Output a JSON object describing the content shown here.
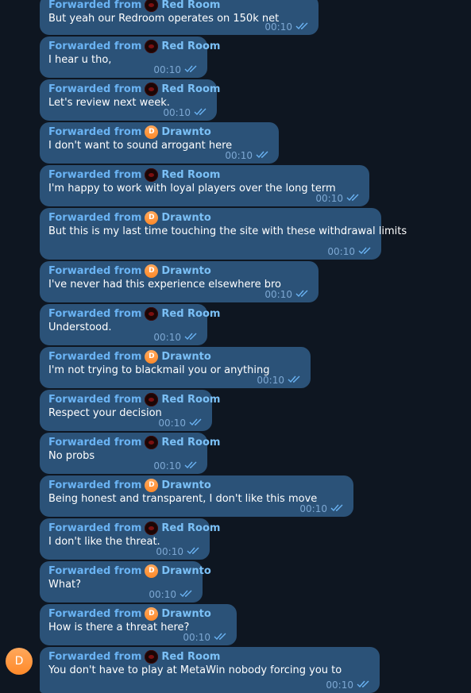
{
  "messages": [
    {
      "forward_label": "Forwarded from",
      "sender": "Red Room",
      "avatar": "red",
      "avatar_initial": "",
      "text": "But yeah our Redroom operates on 150k net",
      "time": "00:10"
    },
    {
      "forward_label": "Forwarded from",
      "sender": "Red Room",
      "avatar": "red",
      "avatar_initial": "",
      "text": "I hear u tho,",
      "time": "00:10"
    },
    {
      "forward_label": "Forwarded from",
      "sender": "Red Room",
      "avatar": "red",
      "avatar_initial": "",
      "text": "Let's review next week.",
      "time": "00:10"
    },
    {
      "forward_label": "Forwarded from",
      "sender": "Drawnto",
      "avatar": "orange",
      "avatar_initial": "D",
      "text": "I don't want to sound arrogant here",
      "time": "00:10"
    },
    {
      "forward_label": "Forwarded from",
      "sender": "Red Room",
      "avatar": "red",
      "avatar_initial": "",
      "text": "I'm happy to work with loyal players over the long term",
      "time": "00:10"
    },
    {
      "forward_label": "Forwarded from",
      "sender": "Drawnto",
      "avatar": "orange",
      "avatar_initial": "D",
      "text": "But this is my last time touching the site with these withdrawal limits",
      "time": "00:10"
    },
    {
      "forward_label": "Forwarded from",
      "sender": "Drawnto",
      "avatar": "orange",
      "avatar_initial": "D",
      "text": "I've never had this experience elsewhere bro",
      "time": "00:10"
    },
    {
      "forward_label": "Forwarded from",
      "sender": "Red Room",
      "avatar": "red",
      "avatar_initial": "",
      "text": "Understood.",
      "time": "00:10"
    },
    {
      "forward_label": "Forwarded from",
      "sender": "Drawnto",
      "avatar": "orange",
      "avatar_initial": "D",
      "text": "I'm not trying to blackmail you or anything",
      "time": "00:10"
    },
    {
      "forward_label": "Forwarded from",
      "sender": "Red Room",
      "avatar": "red",
      "avatar_initial": "",
      "text": "Respect your decision",
      "time": "00:10"
    },
    {
      "forward_label": "Forwarded from",
      "sender": "Red Room",
      "avatar": "red",
      "avatar_initial": "",
      "text": "No probs",
      "time": "00:10"
    },
    {
      "forward_label": "Forwarded from",
      "sender": "Drawnto",
      "avatar": "orange",
      "avatar_initial": "D",
      "text": "Being honest and transparent, I don't like this move",
      "time": "00:10"
    },
    {
      "forward_label": "Forwarded from",
      "sender": "Red Room",
      "avatar": "red",
      "avatar_initial": "",
      "text": "I don't like the threat.",
      "time": "00:10"
    },
    {
      "forward_label": "Forwarded from",
      "sender": "Drawnto",
      "avatar": "orange",
      "avatar_initial": "D",
      "text": "What?",
      "time": "00:10"
    },
    {
      "forward_label": "Forwarded from",
      "sender": "Drawnto",
      "avatar": "orange",
      "avatar_initial": "D",
      "text": "How is there a threat here?",
      "time": "00:10"
    },
    {
      "forward_label": "Forwarded from",
      "sender": "Red Room",
      "avatar": "red",
      "avatar_initial": "",
      "text": "You don't have to play at MetaWin nobody forcing you to",
      "time": "00:10"
    }
  ],
  "chat_avatar": {
    "initial": "D",
    "color": "#ff9a3c"
  },
  "colors": {
    "background": "#0e1621",
    "bubble": "#2b5278",
    "forward_label": "#6ab3f3",
    "time": "#7da8d3",
    "check": "#6ab3f3"
  },
  "icons": {
    "read_status": "double-check-icon"
  }
}
